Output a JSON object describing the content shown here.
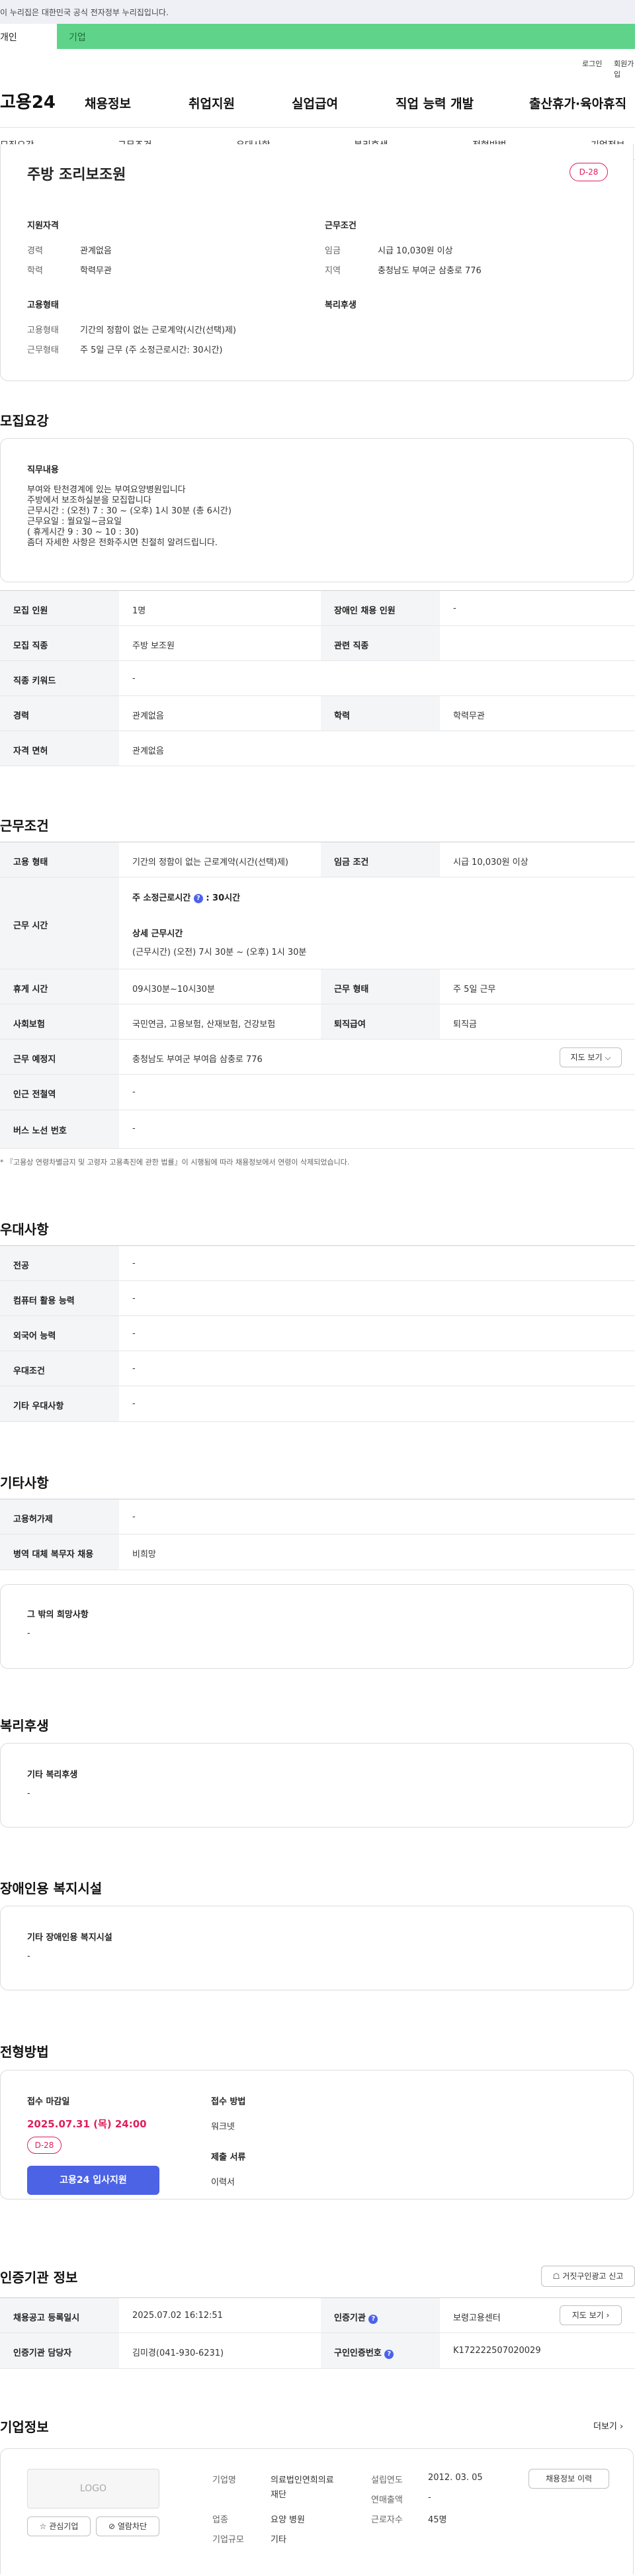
{
  "gov_notice": "이 누리집은 대한민국 공식 전자정부 누리집입니다.",
  "tabs": {
    "personal": "개인",
    "business": "기업"
  },
  "util": {
    "login": "로그인",
    "join": "회원가입"
  },
  "logo": "고용24",
  "gnb": [
    "채용정보",
    "취업지원",
    "실업급여",
    "직업 능력 개발",
    "출산휴가·육아휴직"
  ],
  "snb": [
    "모집요강",
    "근무조건",
    "우대사항",
    "복리후생",
    "전형방법",
    "기업정보"
  ],
  "summary": {
    "title": "주방 조리보조원",
    "dday": "D-28",
    "qual_title": "지원자격",
    "qual": [
      {
        "k": "경력",
        "v": "관계없음"
      },
      {
        "k": "학력",
        "v": "학력무관"
      }
    ],
    "cond_title": "근무조건",
    "cond": [
      {
        "k": "임금",
        "v": "시급 10,030원 이상"
      },
      {
        "k": "지역",
        "v": "충청남도 부여군 삼충로 776"
      }
    ],
    "emp_title": "고용형태",
    "emp": [
      {
        "k": "고용형태",
        "v": "기간의 정함이 없는 근로계약(시간(선택)제)"
      },
      {
        "k": "근무형태",
        "v": "주 5일 근무 (주 소정근로시간: 30시간)"
      }
    ],
    "welfare_title": "복리후생"
  },
  "recruit": {
    "heading": "모집요강",
    "duty_title": "직무내용",
    "duty_lines": [
      "부여와 탄천경계에 있는 부여요양병원입니다",
      "주방에서 보조하실분을 모집합니다",
      "근무시간 : (오전) 7 : 30 ~ (오후) 1시 30분 (총 6시간)",
      "근무요일 :   월요일~금요일",
      "( 휴게시간 9 : 30 ~ 10 : 30)",
      "좀더 자세한 사항은 전화주시면 친절히 알려드립니다."
    ],
    "rows": [
      {
        "k1": "모집 인원",
        "v1": "1명",
        "k2": "장애인 채용 인원",
        "v2": "-"
      },
      {
        "k1": "모집 직종",
        "v1": "주방 보조원",
        "k2": "관련 직종",
        "v2": ""
      },
      {
        "k1": "직종 키워드",
        "v1": "-"
      },
      {
        "k1": "경력",
        "v1": "관계없음",
        "k2": "학력",
        "v2": "학력무관"
      },
      {
        "k1": "자격 면허",
        "v1": "관계없음"
      }
    ]
  },
  "work": {
    "heading": "근무조건",
    "emp_type_k": "고용 형태",
    "emp_type_v": "기간의 정함이 없는 근로계약(시간(선택)제)",
    "wage_k": "임금 조건",
    "wage_v": "시급 10,030원 이상",
    "hours_k": "근무 시간",
    "weekly_label": "주 소정근로시간",
    "weekly_value": ": 30시간",
    "detail_label": "상세 근무시간",
    "detail_value": "(근무시간) (오전) 7시 30분 ~ (오후) 1시 30분",
    "break_k": "휴게 시간",
    "break_v": "09시30분~10시30분",
    "form_k": "근무 형태",
    "form_v": "주 5일 근무",
    "ins_k": "사회보험",
    "ins_v": "국민연금, 고용보험, 산재보험, 건강보험",
    "sev_k": "퇴직급여",
    "sev_v": "퇴직금",
    "loc_k": "근무 예정지",
    "loc_v": "충청남도 부여군 부여읍 삼충로 776",
    "map_btn": "지도 보기",
    "subway_k": "인근 전철역",
    "subway_v": "-",
    "bus_k": "버스 노선 번호",
    "bus_v": "-",
    "notice": "* 『고용상 연령차별금지 및 고령자 고용촉진에 관한 법률』이 시행됨에 따라 채용정보에서 연령이 삭제되었습니다."
  },
  "pref": {
    "heading": "우대사항",
    "rows": [
      {
        "k": "전공",
        "v": "-"
      },
      {
        "k": "컴퓨터 활용 능력",
        "v": "-"
      },
      {
        "k": "외국어 능력",
        "v": "-"
      },
      {
        "k": "우대조건",
        "v": "-"
      },
      {
        "k": "기타 우대사항",
        "v": "-"
      }
    ]
  },
  "etc": {
    "heading": "기타사항",
    "rows": [
      {
        "k": "고용허가제",
        "v": "-"
      },
      {
        "k": "병역 대체 복무자 채용",
        "v": "비희망"
      }
    ],
    "other_title": "그 밖의 희망사항",
    "other_value": "-"
  },
  "welfare": {
    "heading": "복리후생",
    "title": "기타 복리후생",
    "value": "-"
  },
  "disab": {
    "heading": "장애인용 복지시설",
    "title": "기타 장애인용 복지시설",
    "value": "-"
  },
  "selection": {
    "heading": "전형방법",
    "deadline_label": "접수 마감일",
    "deadline": "2025.07.31 (목) 24:00",
    "dday": "D-28",
    "apply_btn": "고용24 입사지원",
    "method_label": "접수 방법",
    "method": "워크넷",
    "docs_label": "제출 서류",
    "docs": "이력서"
  },
  "cert": {
    "heading": "인증기관 정보",
    "report_btn": "거짓구인광고 신고",
    "rows": [
      {
        "k1": "채용공고 등록일시",
        "v1": "2025.07.02 16:12:51",
        "k2": "인증기관",
        "v2": "보령고용센터"
      },
      {
        "k1": "인증기관 담당자",
        "v1": "김미경(041-930-6231)",
        "k2": "구인인증번호",
        "v2": "K172222507020029"
      }
    ],
    "map_btn": "지도 보기"
  },
  "company": {
    "heading": "기업정보",
    "more": "더보기",
    "logo_text": "LOGO",
    "fav_btn": "관심기업",
    "block_btn": "열람차단",
    "name_k": "기업명",
    "name_v1": "의료법인연희의료",
    "name_v2": "재단",
    "found_k": "설립연도",
    "found_v": "2012. 03. 05",
    "hist_btn": "채용정보 이력",
    "sales_k": "연매출액",
    "sales_v": "-",
    "ind_k": "업종",
    "ind_v": "요양 병원",
    "emp_k": "근로자수",
    "emp_v": "45명",
    "size_k": "기업규모",
    "size_v": "기타"
  },
  "colors": {
    "green": "#5fd38a",
    "dday": "#e01e5a",
    "primary": "#4c63e6",
    "deadline": "#e01e5a"
  }
}
